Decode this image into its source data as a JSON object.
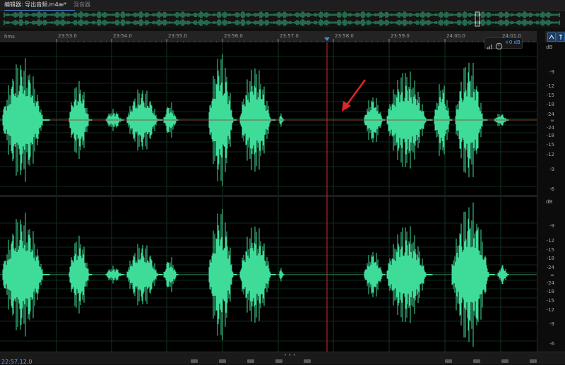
{
  "tabs": {
    "editor_label": "编辑器: 导出音频.m4a *",
    "menu_glyph": "≡",
    "mixer_label": "混音器"
  },
  "ruler": {
    "unit_label": "hms",
    "ticks": [
      "23:53.0",
      "23:54.0",
      "23:55.0",
      "23:56.0",
      "23:57.0",
      "23:58.0",
      "23:59.0",
      "24:00.0",
      "24:01.0"
    ]
  },
  "hud": {
    "gain_label": "+0 dB"
  },
  "db_scale": {
    "unit": "dB",
    "top_channel": [
      "-9",
      "-12",
      "-15",
      "-18",
      "-24",
      "∞",
      "-24",
      "-18",
      "-15",
      "-12",
      "-9",
      "-6"
    ],
    "top_channel_low": [
      "-9",
      "-6"
    ],
    "bottom_channel": [
      "-9",
      "-12",
      "-15",
      "-18",
      "-24",
      "∞",
      "-24",
      "-18",
      "-15",
      "-12",
      "-9",
      "-6"
    ]
  },
  "colors": {
    "waveform": "#3fdc99",
    "playhead": "#e0262b",
    "arrow": "#e0262b",
    "accent": "#4a90e2",
    "background": "#000000"
  },
  "status": {
    "time": "22:57.12.0"
  },
  "icons": {
    "clock": "clock-icon",
    "volume": "volume-icon",
    "pin": "pin-icon",
    "zoom": "zoom-icon"
  }
}
